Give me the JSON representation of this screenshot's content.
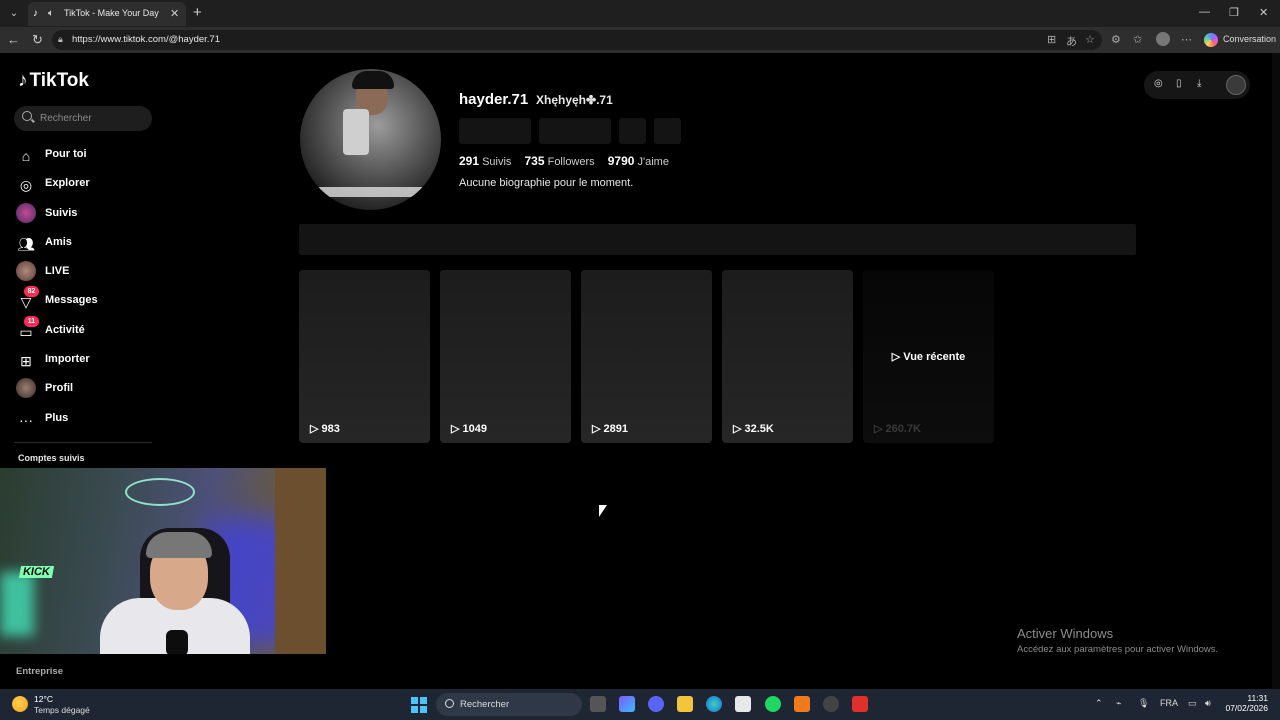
{
  "browser": {
    "tab_title": "TikTok - Make Your Day",
    "url": "https://www.tiktok.com/@hayder.71",
    "conversation_label": "Conversation"
  },
  "sidebar": {
    "logo": "TikTok",
    "search_placeholder": "Rechercher",
    "items": [
      {
        "label": "Pour toi",
        "icon": "home-icon"
      },
      {
        "label": "Explorer",
        "icon": "compass-icon"
      },
      {
        "label": "Suivis",
        "icon": "following-avatar"
      },
      {
        "label": "Amis",
        "icon": "friends-icon"
      },
      {
        "label": "LIVE",
        "icon": "live-avatar"
      },
      {
        "label": "Messages",
        "icon": "messages-icon",
        "badge": "82"
      },
      {
        "label": "Activité",
        "icon": "activity-icon",
        "badge": "11"
      },
      {
        "label": "Importer",
        "icon": "upload-icon"
      },
      {
        "label": "Profil",
        "icon": "profile-avatar"
      },
      {
        "label": "Plus",
        "icon": "more-icon"
      }
    ],
    "following_heading": "Comptes suivis",
    "company": "Entreprise"
  },
  "profile": {
    "username": "hayder.71",
    "nickname": "Xhęhyęh✤.71",
    "following_count": "291",
    "following_label": "Suivis",
    "followers_count": "735",
    "followers_label": "Followers",
    "likes_count": "9790",
    "likes_label": "J'aime",
    "bio": "Aucune biographie pour le moment."
  },
  "videos": [
    {
      "views": "983"
    },
    {
      "views": "1049"
    },
    {
      "views": "2891"
    },
    {
      "views": "32.5K"
    },
    {
      "views": "260.7K",
      "overlay": "Vue récente"
    }
  ],
  "windows_notice": {
    "title": "Activer Windows",
    "subtitle": "Accédez aux paramètres pour activer Windows."
  },
  "taskbar": {
    "temperature": "12°C",
    "weather": "Temps dégagé",
    "search": "Rechercher",
    "language": "FRA",
    "time": "11:31",
    "date": "07/02/2026"
  }
}
